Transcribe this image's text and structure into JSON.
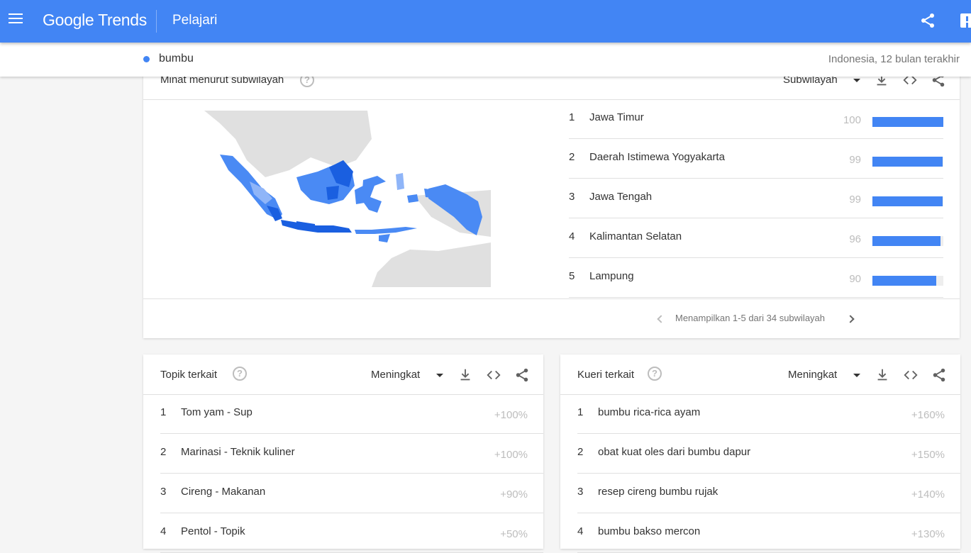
{
  "header": {
    "logo_google": "Google",
    "logo_trends": "Trends",
    "section": "Pelajari"
  },
  "search_term": {
    "label": "bumbu",
    "color": "#4285f4",
    "context": "Indonesia, 12 bulan terakhir"
  },
  "region_card": {
    "title": "Minat menurut subwilayah",
    "dropdown": "Subwilayah",
    "rows": [
      {
        "rank": "1",
        "name": "Jawa Timur",
        "value": "100",
        "fill": 100
      },
      {
        "rank": "2",
        "name": "Daerah Istimewa Yogyakarta",
        "value": "99",
        "fill": 99
      },
      {
        "rank": "3",
        "name": "Jawa Tengah",
        "value": "99",
        "fill": 99
      },
      {
        "rank": "4",
        "name": "Kalimantan Selatan",
        "value": "96",
        "fill": 96
      },
      {
        "rank": "5",
        "name": "Lampung",
        "value": "90",
        "fill": 90
      }
    ],
    "pager_text": "Menampilkan 1-5 dari 34 subwilayah"
  },
  "topics_card": {
    "title": "Topik terkait",
    "dropdown": "Meningkat",
    "rows": [
      {
        "rank": "1",
        "name": "Tom yam - Sup",
        "value": "+100%"
      },
      {
        "rank": "2",
        "name": "Marinasi - Teknik kuliner",
        "value": "+100%"
      },
      {
        "rank": "3",
        "name": "Cireng - Makanan",
        "value": "+90%"
      },
      {
        "rank": "4",
        "name": "Pentol - Topik",
        "value": "+50%"
      }
    ]
  },
  "queries_card": {
    "title": "Kueri terkait",
    "dropdown": "Meningkat",
    "rows": [
      {
        "rank": "1",
        "name": "bumbu rica-rica ayam",
        "value": "+160%"
      },
      {
        "rank": "2",
        "name": "obat kuat oles dari bumbu dapur",
        "value": "+150%"
      },
      {
        "rank": "3",
        "name": "resep cireng bumbu rujak",
        "value": "+140%"
      },
      {
        "rank": "4",
        "name": "bumbu bakso mercon",
        "value": "+130%"
      }
    ]
  },
  "icons": {
    "menu": "menu-icon",
    "share": "share-icon",
    "feedback": "feedback-icon",
    "download": "download-icon",
    "embed": "embed-icon",
    "help": "help-icon"
  },
  "colors": {
    "brand": "#4285f4",
    "map_high": "#1a5fe0",
    "map_mid": "#4a8af4",
    "map_low": "#8fb5f8",
    "map_land": "#e0e0e0"
  }
}
